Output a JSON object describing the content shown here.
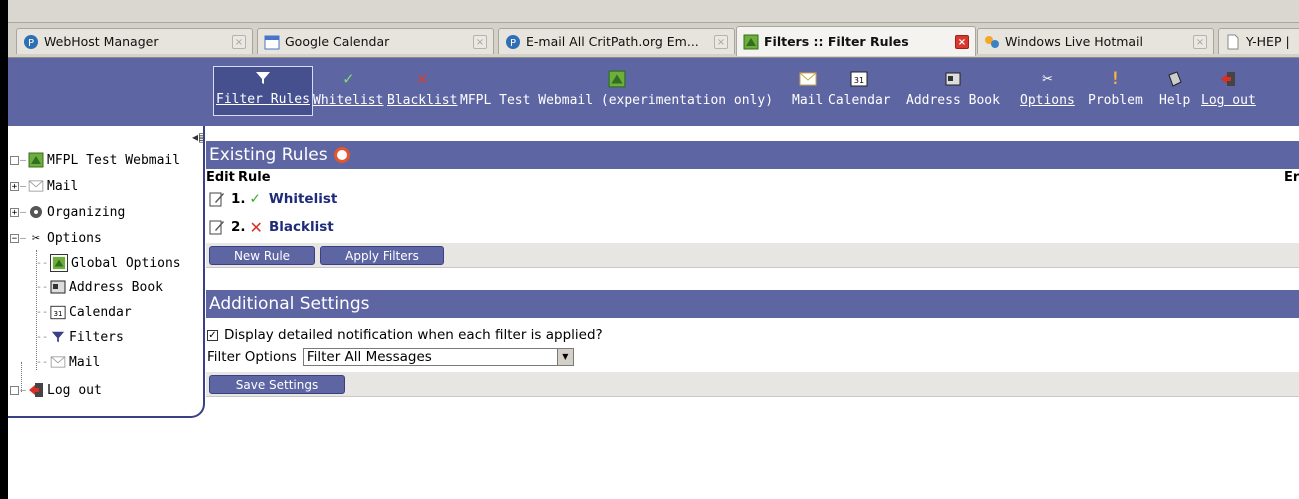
{
  "browser": {
    "tabs": [
      {
        "label": "WebHost Manager",
        "active": false
      },
      {
        "label": "Google Calendar",
        "active": false
      },
      {
        "label": "E-mail All CritPath.org Em...",
        "active": false
      },
      {
        "label": "Filters :: Filter Rules",
        "active": true
      },
      {
        "label": "Windows Live Hotmail",
        "active": false
      },
      {
        "label": "Y-HEP | ",
        "active": false
      }
    ]
  },
  "nav": {
    "items": [
      {
        "label": "Filter Rules",
        "icon": "filter-icon"
      },
      {
        "label": "Whitelist",
        "icon": "checkmark-icon"
      },
      {
        "label": "Blacklist",
        "icon": "x-icon"
      },
      {
        "label": "MFPL Test Webmail (experimentation only)",
        "icon": "portal-icon"
      },
      {
        "label": "Mail",
        "icon": "envelope-icon"
      },
      {
        "label": "Calendar",
        "icon": "calendar-icon"
      },
      {
        "label": "Address Book",
        "icon": "address-book-icon"
      },
      {
        "label": "Options",
        "icon": "tools-icon"
      },
      {
        "label": "Problem",
        "icon": "exclamation-icon"
      },
      {
        "label": "Help",
        "icon": "help-icon"
      },
      {
        "label": "Log out",
        "icon": "logout-icon"
      }
    ]
  },
  "sidebar": {
    "root": "MFPL Test Webmail",
    "mail": "Mail",
    "organizing": "Organizing",
    "options": "Options",
    "children": [
      "Global Options",
      "Address Book",
      "Calendar",
      "Filters",
      "Mail"
    ],
    "logout": "Log out"
  },
  "existing_rules": {
    "title": "Existing Rules",
    "col_edit": "Edit",
    "col_rule": "Rule",
    "col_right": "Er",
    "rules": [
      {
        "num": "1.",
        "name": "Whitelist"
      },
      {
        "num": "2.",
        "name": "Blacklist"
      }
    ],
    "new_rule": "New Rule",
    "apply_filters": "Apply Filters"
  },
  "additional": {
    "title": "Additional Settings",
    "notify_label": "Display detailed notification when each filter is applied?",
    "notify_checked": true,
    "filter_options_label": "Filter Options",
    "filter_options_value": "Filter All Messages",
    "save": "Save Settings"
  },
  "colors": {
    "accent": "#5e65a3",
    "border": "#3a3f86"
  }
}
